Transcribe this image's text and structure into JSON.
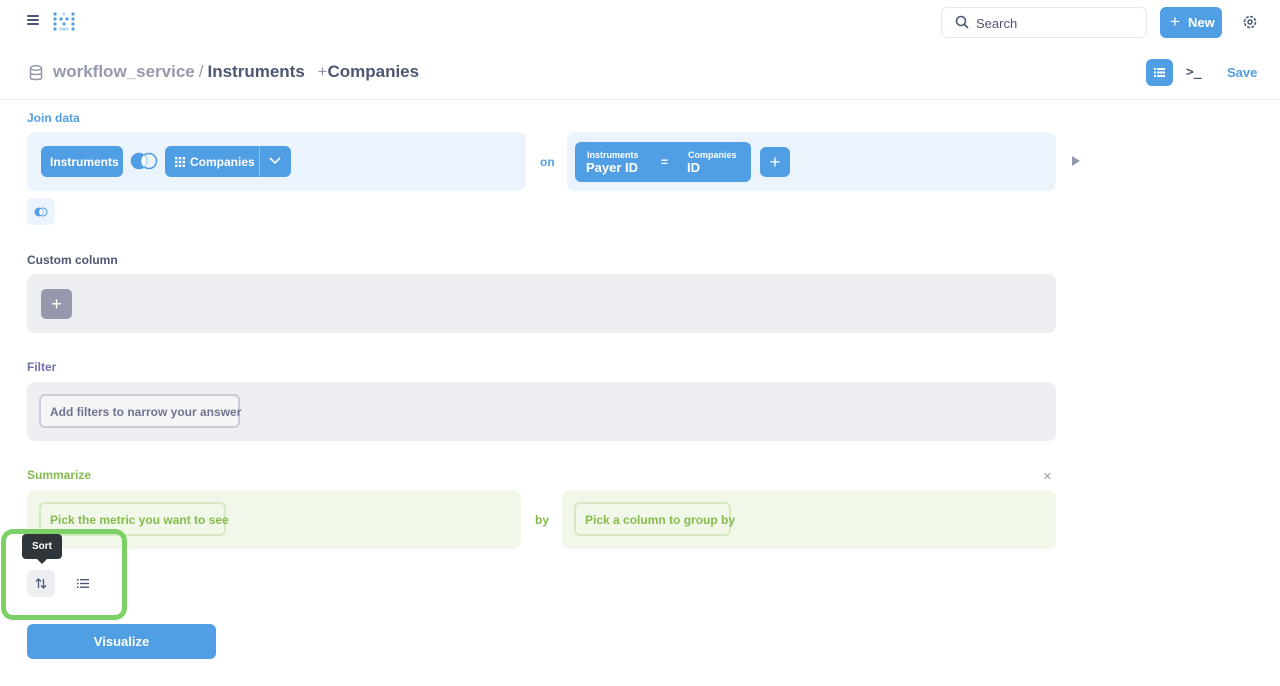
{
  "topnav": {
    "menu_icon": "hamburger-icon",
    "logo_icon": "metabase-logo",
    "search_placeholder": "Search",
    "new_label": "New",
    "settings_icon": "gear-icon"
  },
  "header": {
    "database": "workflow_service",
    "separator": "/",
    "table": "Instruments",
    "plus": "+",
    "joined_table": "Companies",
    "save_label": "Save",
    "sql_label": ">_"
  },
  "join": {
    "section_label": "Join data",
    "left_table": "Instruments",
    "right_table": "Companies",
    "on_label": "on",
    "left_field_table": "Instruments",
    "left_field": "Payer ID",
    "operator": "=",
    "right_field_table": "Companies",
    "right_field": "ID",
    "add_label": "+"
  },
  "custom_column": {
    "section_label": "Custom column",
    "add_label": "+"
  },
  "filter": {
    "section_label": "Filter",
    "placeholder": "Add filters to narrow your answer"
  },
  "summarize": {
    "section_label": "Summarize",
    "metric_placeholder": "Pick the metric you want to see",
    "by_label": "by",
    "group_placeholder": "Pick a column to group by",
    "close_label": "×"
  },
  "actions": {
    "tooltip": "Sort",
    "sort_icon": "sort-icon",
    "limit_icon": "list-icon"
  },
  "visualize_label": "Visualize",
  "colors": {
    "brand": "#509ee3",
    "summarize": "#84bb4c",
    "filter": "#7172ad",
    "highlight": "#7dd065"
  }
}
